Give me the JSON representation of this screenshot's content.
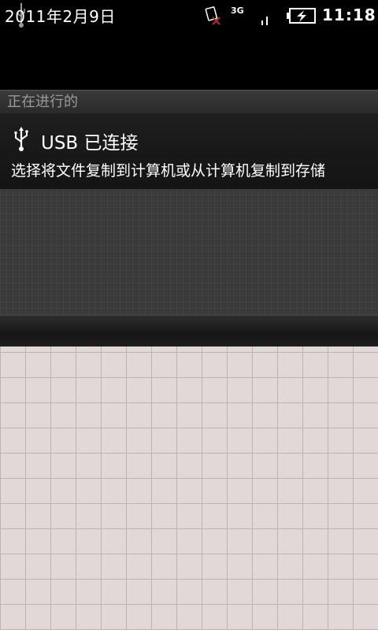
{
  "status_bar": {
    "date": "2011年2月9日",
    "network_type": "3G",
    "clock": "11:18",
    "icons": [
      "usb-icon",
      "no-sim-icon",
      "signal-icon",
      "battery-charging-icon"
    ]
  },
  "notifications": {
    "section_label": "正在进行的",
    "items": [
      {
        "icon": "usb-icon",
        "title": "USB 已连接",
        "message": "选择将文件复制到计算机或从计算机复制到存储"
      }
    ]
  },
  "colors": {
    "panel_background": "#3a3a3a",
    "wallpaper": "#e2d8d8",
    "sim_error_mark": "#c0292b"
  }
}
